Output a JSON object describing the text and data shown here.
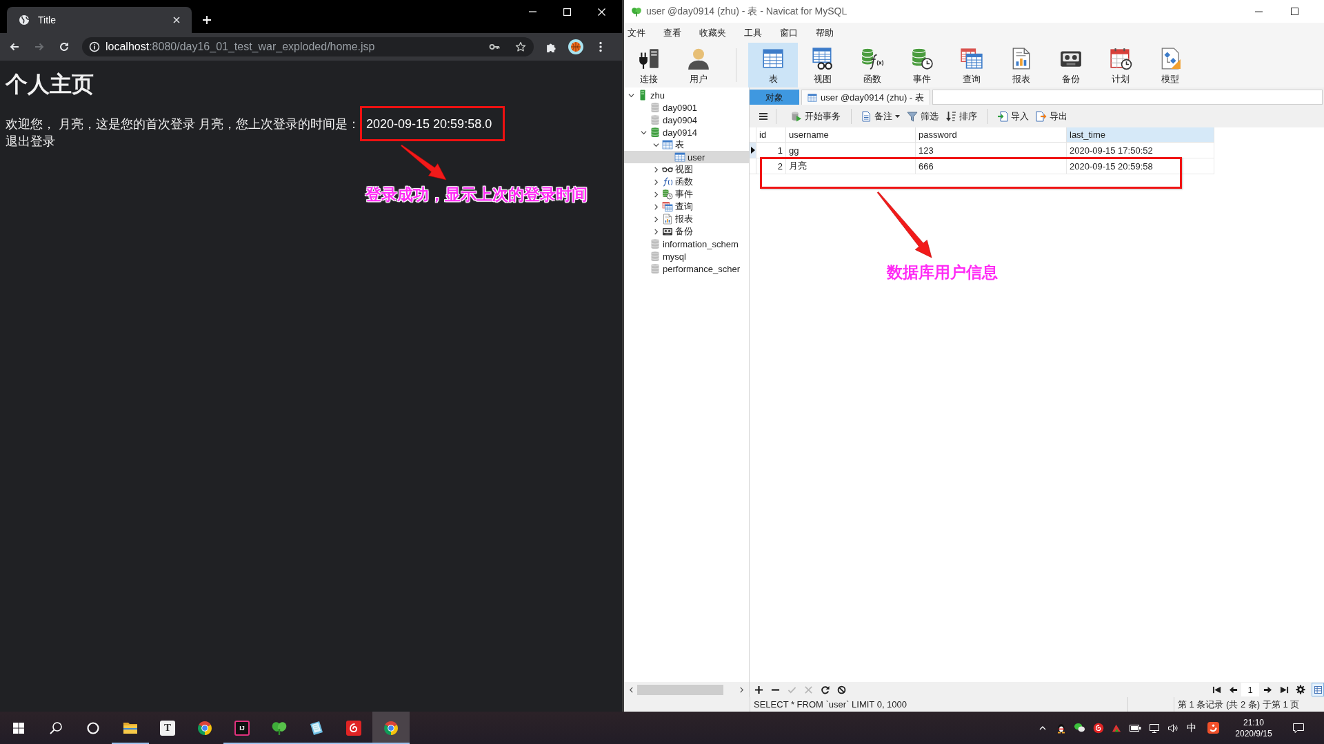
{
  "browser": {
    "tab": {
      "title": "Title",
      "selected": true
    },
    "nav_buttons": [
      {
        "kind": "back",
        "disabled": false
      },
      {
        "kind": "forward",
        "disabled": true
      },
      {
        "kind": "reload",
        "disabled": false
      }
    ],
    "address": {
      "host": "localhost",
      "rest": ":8080/day16_01_test_war_exploded/home.jsp"
    },
    "page": {
      "heading": "个人主页",
      "welcome": "欢迎您， 月亮，这是您的首次登录 月亮，您上次登录的时间是：",
      "last_login": "2020-09-15 20:59:58.0",
      "logout": "退出登录"
    },
    "annotation": "登录成功，显示上次的登录时间"
  },
  "navicat": {
    "title": "user @day0914 (zhu) - 表 - Navicat for MySQL",
    "menu": [
      "文件",
      "查看",
      "收藏夹",
      "工具",
      "窗口",
      "帮助"
    ],
    "toolbar_groups": [
      [
        {
          "kind": "connection",
          "label": "连接",
          "selected": false
        },
        {
          "kind": "user",
          "label": "用户",
          "selected": false
        }
      ],
      [
        {
          "kind": "table",
          "label": "表",
          "selected": true
        },
        {
          "kind": "view",
          "label": "视图",
          "selected": false
        },
        {
          "kind": "function",
          "label": "函数",
          "selected": false
        },
        {
          "kind": "event",
          "label": "事件",
          "selected": false
        },
        {
          "kind": "query",
          "label": "查询",
          "selected": false
        },
        {
          "kind": "report",
          "label": "报表",
          "selected": false
        },
        {
          "kind": "backup",
          "label": "备份",
          "selected": false
        },
        {
          "kind": "schedule",
          "label": "计划",
          "selected": false
        },
        {
          "kind": "model",
          "label": "模型",
          "selected": false
        }
      ]
    ],
    "tree": [
      {
        "kind": "connection",
        "name": "zhu",
        "expanded": true,
        "selected": false,
        "children": [
          {
            "kind": "database",
            "name": "day0901",
            "open": false,
            "selected": false
          },
          {
            "kind": "database",
            "name": "day0904",
            "open": false,
            "selected": false
          },
          {
            "kind": "database",
            "name": "day0914",
            "open": true,
            "expanded": true,
            "selected": false,
            "children": [
              {
                "kind": "tables",
                "name": "表",
                "expanded": true,
                "selected": false,
                "children": [
                  {
                    "kind": "table",
                    "name": "user",
                    "selected": true
                  }
                ]
              },
              {
                "kind": "views",
                "name": "视图",
                "expanded": false,
                "selected": false
              },
              {
                "kind": "functions",
                "name": "函数",
                "expanded": false,
                "selected": false
              },
              {
                "kind": "events",
                "name": "事件",
                "expanded": false,
                "selected": false
              },
              {
                "kind": "queries",
                "name": "查询",
                "expanded": false,
                "selected": false
              },
              {
                "kind": "reports",
                "name": "报表",
                "expanded": false,
                "selected": false
              },
              {
                "kind": "backups",
                "name": "备份",
                "expanded": false,
                "selected": false
              }
            ]
          },
          {
            "kind": "database",
            "name": "information_schem",
            "open": false,
            "selected": false
          },
          {
            "kind": "database",
            "name": "mysql",
            "open": false,
            "selected": false
          },
          {
            "kind": "database",
            "name": "performance_scher",
            "open": false,
            "selected": false
          }
        ]
      }
    ],
    "tabs": [
      {
        "kind": "objects",
        "label": "对象",
        "selected": false
      },
      {
        "kind": "table",
        "label": "user @day0914 (zhu) - 表",
        "selected": true
      }
    ],
    "action_groups": [
      [
        {
          "kind": "transaction",
          "label": "开始事务",
          "dropdown": false
        }
      ],
      [
        {
          "kind": "comment",
          "label": "备注",
          "dropdown": true
        },
        {
          "kind": "filter",
          "label": "筛选",
          "dropdown": false
        },
        {
          "kind": "sort",
          "label": "排序",
          "dropdown": false
        }
      ],
      [
        {
          "kind": "import",
          "label": "导入",
          "dropdown": false
        },
        {
          "kind": "export",
          "label": "导出",
          "dropdown": false
        }
      ]
    ],
    "grid": {
      "columns": [
        {
          "label": "id",
          "selected": false
        },
        {
          "label": "username",
          "selected": false
        },
        {
          "label": "password",
          "selected": false
        },
        {
          "label": "last_time",
          "selected": true
        }
      ],
      "rows": [
        {
          "selected": true,
          "cells": [
            "1",
            "gg",
            "123",
            "2020-09-15 17:50:52"
          ]
        },
        {
          "selected": false,
          "cells": [
            "2",
            "月亮",
            "666",
            "2020-09-15 20:59:58"
          ]
        }
      ]
    },
    "record_controls": [
      {
        "kind": "add",
        "disabled": false
      },
      {
        "kind": "delete",
        "disabled": false
      },
      {
        "kind": "apply",
        "disabled": true
      },
      {
        "kind": "discard",
        "disabled": true
      },
      {
        "kind": "refresh",
        "disabled": false
      },
      {
        "kind": "stop",
        "disabled": false
      }
    ],
    "page_number": "1",
    "status": {
      "sql": "SELECT * FROM `user` LIMIT 0, 1000",
      "records": "第 1 条记录 (共 2 条) 于第 1 页"
    },
    "annotation": "数据库用户信息"
  },
  "taskbar": {
    "apps": [
      {
        "kind": "folder",
        "running": true,
        "selected": false
      },
      {
        "kind": "letter-tile",
        "glyph": "T",
        "running": false,
        "selected": false
      },
      {
        "kind": "browser",
        "running": false,
        "selected": false
      },
      {
        "kind": "ide-tile",
        "glyph": "IJ",
        "running": true,
        "selected": false
      },
      {
        "kind": "leaf",
        "running": true,
        "selected": false
      },
      {
        "kind": "notebook",
        "running": true,
        "selected": false
      },
      {
        "kind": "music",
        "running": true,
        "selected": false
      },
      {
        "kind": "browser",
        "running": true,
        "selected": true
      }
    ],
    "ime": "中",
    "time": "21:10",
    "date": "2020/9/15"
  }
}
